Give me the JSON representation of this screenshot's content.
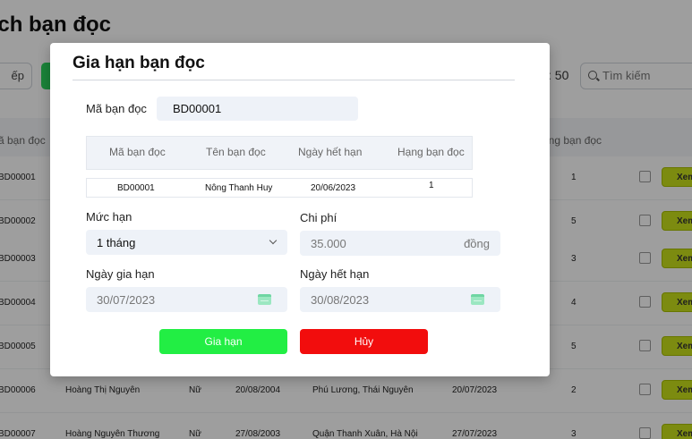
{
  "background": {
    "page_title": "ách bạn đọc",
    "sort_label": "ếp",
    "page_size": ": 50",
    "search_placeholder": "Tìm kiếm",
    "headers": {
      "id": "ã bạn đọc",
      "rank": "ạng bạn đọc"
    },
    "view_label": "Xem",
    "rows": [
      {
        "id": "BD00001",
        "name": "",
        "gender": "",
        "dob": "",
        "address": "",
        "expiry": "",
        "rank": "1"
      },
      {
        "id": "BD00002",
        "name": "",
        "gender": "",
        "dob": "",
        "address": "",
        "expiry": "",
        "rank": "5"
      },
      {
        "id": "BD00003",
        "name": "",
        "gender": "",
        "dob": "",
        "address": "",
        "expiry": "",
        "rank": "3"
      },
      {
        "id": "BD00004",
        "name": "",
        "gender": "",
        "dob": "",
        "address": "",
        "expiry": "",
        "rank": "4"
      },
      {
        "id": "BD00005",
        "name": "",
        "gender": "",
        "dob": "",
        "address": "",
        "expiry": "",
        "rank": "5"
      },
      {
        "id": "BD00006",
        "name": "Hoàng Thị Nguyên",
        "gender": "Nữ",
        "dob": "20/08/2004",
        "address": "Phú Lương, Thái Nguyên",
        "expiry": "20/07/2023",
        "rank": "2"
      },
      {
        "id": "BD00007",
        "name": "Hoàng Nguyên Thương",
        "gender": "Nữ",
        "dob": "27/08/2003",
        "address": "Quận Thanh Xuân, Hà Nội",
        "expiry": "27/07/2023",
        "rank": "3"
      }
    ]
  },
  "modal": {
    "title": "Gia hạn bạn đọc",
    "reader_id_label": "Mã bạn đọc",
    "reader_id_value": "BD00001",
    "table_headers": [
      "Mã bạn đọc",
      "Tên bạn đọc",
      "Ngày hết hạn",
      "Hạng bạn đọc"
    ],
    "table_row": [
      "BD00001",
      "Nông Thanh Huy",
      "20/06/2023",
      "1"
    ],
    "term_label": "Mức hạn",
    "term_value": "1 tháng",
    "cost_label": "Chi phí",
    "cost_value": "35.000",
    "cost_unit": "đồng",
    "renew_date_label": "Ngày gia hạn",
    "renew_date_value": "30/07/2023",
    "new_expiry_label": "Ngày hết hạn",
    "new_expiry_value": "30/08/2023",
    "extend_button": "Gia hạn",
    "cancel_button": "Hủy",
    "colors": {
      "extend": "#22ee44",
      "cancel": "#f20d0d",
      "view": "#c9e01a",
      "calendar_icon": "#9be7c1"
    }
  }
}
